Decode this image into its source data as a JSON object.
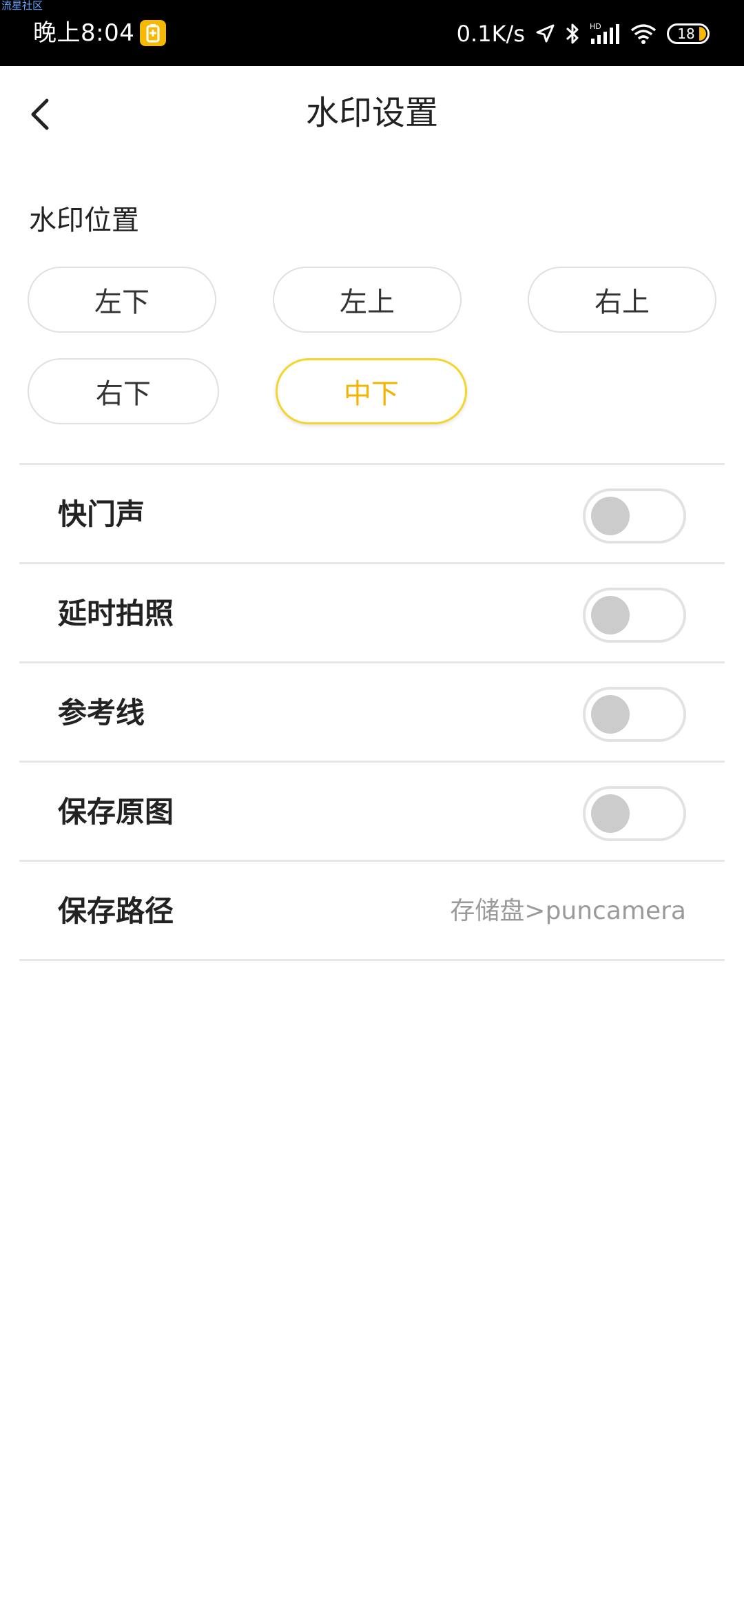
{
  "status_bar": {
    "overlay_tag": "流星社区",
    "time": "晚上8:04",
    "net_speed": "0.1K/s",
    "signal_badge": "HD",
    "battery": "18",
    "icons": [
      "app-notification-icon",
      "location-arrow-icon",
      "bluetooth-icon",
      "signal-icon",
      "wifi-icon",
      "battery-icon"
    ],
    "accent_color": "#f6b900"
  },
  "header": {
    "back_icon": "chevron-left-icon",
    "title": "水印设置"
  },
  "watermark_position": {
    "label": "水印位置",
    "options": [
      "左下",
      "左上",
      "右上",
      "右下",
      "中下"
    ],
    "selected": "中下",
    "selected_color": "#f2b400"
  },
  "settings": {
    "shutter_sound": {
      "label": "快门声",
      "on": false
    },
    "timer_photo": {
      "label": "延时拍照",
      "on": false
    },
    "grid_lines": {
      "label": "参考线",
      "on": false
    },
    "save_original": {
      "label": "保存原图",
      "on": false
    },
    "save_path": {
      "label": "保存路径",
      "value": "存储盘>puncamera"
    }
  }
}
